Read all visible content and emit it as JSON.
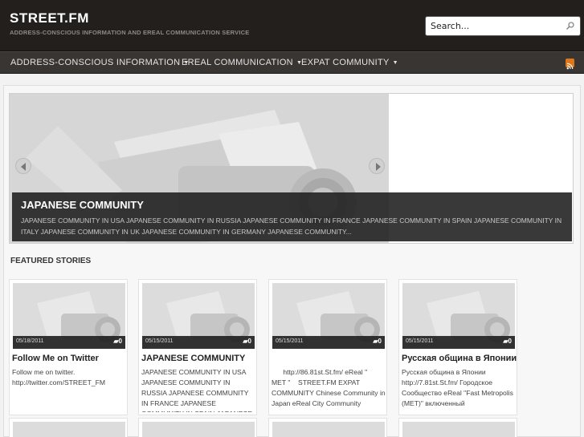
{
  "site": {
    "title": "STREET.FM",
    "description": "ADDRESS-CONSCIOUS INFORMATION AND EREAL COMMUNICATION SERVICE"
  },
  "search": {
    "placeholder": "Search...",
    "icon": "search-icon"
  },
  "nav": {
    "items": [
      {
        "label": "ADDRESS-CONSCIOUS INFORMATION",
        "caret": "▼"
      },
      {
        "label": "EREAL COMMUNICATION",
        "caret": "▼"
      },
      {
        "label": "EXPAT COMMUNITY",
        "caret": "▼"
      }
    ],
    "rss_icon": "rss-icon"
  },
  "slider": {
    "title": "JAPANESE COMMUNITY",
    "text": "JAPANESE COMMUNITY IN USA JAPANESE COMMUNITY IN RUSSIA JAPANESE COMMUNITY IN FRANCE JAPANESE COMMUNITY IN SPAIN JAPANESE COMMUNITY IN ITALY JAPANESE COMMUNITY IN UK JAPANESE COMMUNITY IN GERMANY JAPANESE COMMUNITY..."
  },
  "featured": {
    "heading": "FEATURED STORIES",
    "cards": [
      {
        "date": "05/18/2011",
        "comments": "0",
        "title": "Follow Me on Twitter",
        "body": "Follow me on twitter. http://twitter.com/STREET_FM"
      },
      {
        "date": "05/15/2011",
        "comments": "0",
        "title": "JAPANESE COMMUNITY",
        "body": "JAPANESE COMMUNITY IN USA JAPANESE COMMUNITY IN RUSSIA JAPANESE COMMUNITY IN FRANCE JAPANESE COMMUNITY IN SPAIN JAPANESE"
      },
      {
        "date": "05/15/2011",
        "comments": "0",
        "title": "",
        "body": "      http://86.81st.St.fm/ eReal \"   MET \"    STREET.FM EXPAT COMMUNITY Chinese Community in Japan eReal City Community"
      },
      {
        "date": "05/15/2011",
        "comments": "0",
        "title": "Русская община в Японии",
        "body": "Русская община в Японии http://7.81st.St.fm/ Городское Сообщество eReal \"Fast Metropolis (MET)\" включенный"
      }
    ]
  },
  "colors": {
    "header_bg": "#221f1d",
    "nav_bg": "#393533",
    "rss": "#e0761a"
  }
}
